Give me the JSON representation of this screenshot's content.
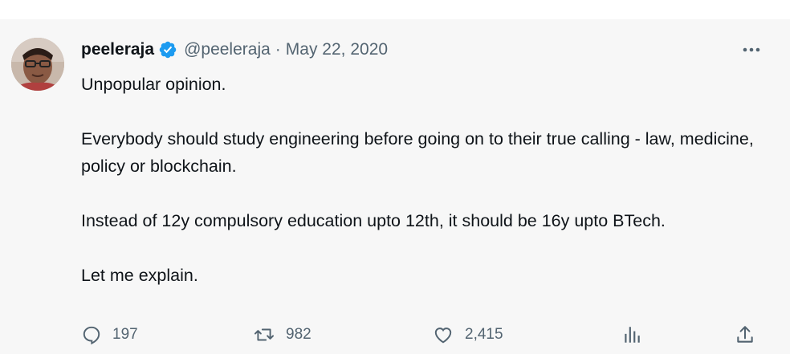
{
  "tweet": {
    "display_name": "peeleraja",
    "handle": "@peeleraja",
    "separator": "·",
    "date": "May 22, 2020",
    "paragraphs": [
      "Unpopular opinion.",
      "Everybody should study engineering before going on to their true calling - law, medicine, policy or blockchain.",
      "Instead of 12y compulsory education upto 12th, it should be 16y upto BTech.",
      "Let me explain."
    ],
    "verified": true
  },
  "actions": {
    "reply_count": "197",
    "retweet_count": "982",
    "like_count": "2,415"
  },
  "icons": {
    "verified": "verified-badge-icon",
    "more": "more-options-icon",
    "reply": "reply-icon",
    "retweet": "retweet-icon",
    "like": "heart-icon",
    "views": "analytics-icon",
    "share": "share-icon"
  },
  "colors": {
    "verified_blue": "#1d9bf0",
    "secondary_text": "#536471",
    "primary_text": "#0f1419",
    "card_background": "#f7f7f7"
  }
}
